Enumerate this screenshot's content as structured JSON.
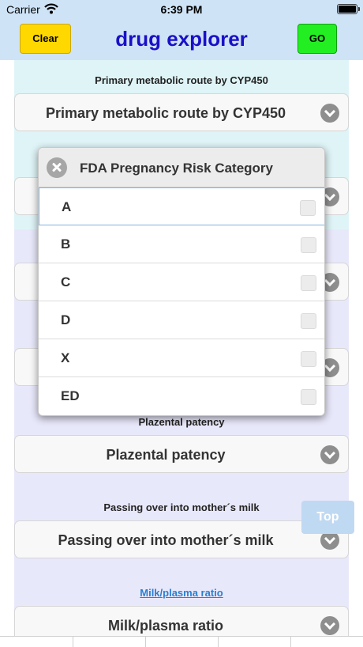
{
  "status_bar": {
    "carrier": "Carrier",
    "time": "6:39 PM"
  },
  "nav": {
    "clear_label": "Clear",
    "title": "drug explorer",
    "go_label": "GO"
  },
  "sections": [
    {
      "title": "Primary metabolic route by CYP450",
      "value": "Primary metabolic route by CYP450",
      "band_color": "#dff4f7"
    },
    {
      "title": "",
      "value": "",
      "band_color": "#dff4f7"
    },
    {
      "title": "",
      "value": "",
      "band_color": "#e8e8fb"
    },
    {
      "title": "",
      "value": "",
      "band_color": "#e8e8fb"
    },
    {
      "title": "Plazental patency",
      "value": "Plazental patency",
      "band_color": "#e8e8fb"
    },
    {
      "title": "Passing over into mother´s milk",
      "value": "Passing over into mother´s milk",
      "band_color": "#e8e8fb"
    },
    {
      "title": "Milk/plasma ratio",
      "value": "Milk/plasma ratio",
      "band_color": "#e8e8fb"
    }
  ],
  "picker": {
    "title": "FDA Pregnancy Risk Category",
    "options": [
      {
        "label": "A",
        "checked": false,
        "highlighted": true
      },
      {
        "label": "B",
        "checked": false
      },
      {
        "label": "C",
        "checked": false
      },
      {
        "label": "D",
        "checked": false
      },
      {
        "label": "X",
        "checked": false
      },
      {
        "label": "ED",
        "checked": false
      }
    ]
  },
  "top_button": {
    "label": "Top"
  },
  "colors": {
    "navbar": "#cfe3f6",
    "clear_button": "#ffd800",
    "go_button": "#22ee22",
    "title_text": "#1a10c8",
    "link": "#2a7fd0"
  }
}
